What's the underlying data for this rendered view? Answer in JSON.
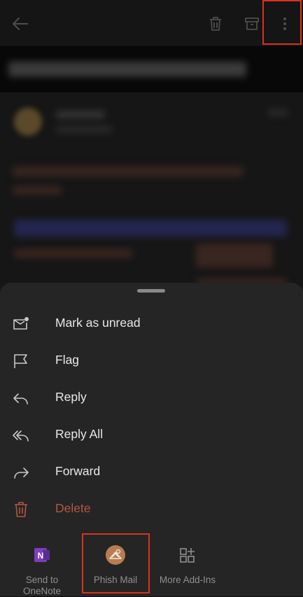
{
  "menu": {
    "items": [
      {
        "label": "Mark as unread",
        "icon": "mail-unread-icon"
      },
      {
        "label": "Flag",
        "icon": "flag-icon"
      },
      {
        "label": "Reply",
        "icon": "reply-icon"
      },
      {
        "label": "Reply All",
        "icon": "reply-all-icon"
      },
      {
        "label": "Forward",
        "icon": "forward-icon"
      },
      {
        "label": "Delete",
        "icon": "delete-icon"
      }
    ]
  },
  "addins": [
    {
      "label": "Send to OneNote",
      "icon": "onenote-icon"
    },
    {
      "label": "Phish Mail",
      "icon": "phish-mail-icon"
    },
    {
      "label": "More Add-Ins",
      "icon": "add-apps-icon"
    }
  ],
  "colors": {
    "accent_highlight": "#d9321f",
    "delete_text": "#b4563f",
    "sheet_background": "#252525",
    "onenote_purple": "#7b3fbf"
  }
}
